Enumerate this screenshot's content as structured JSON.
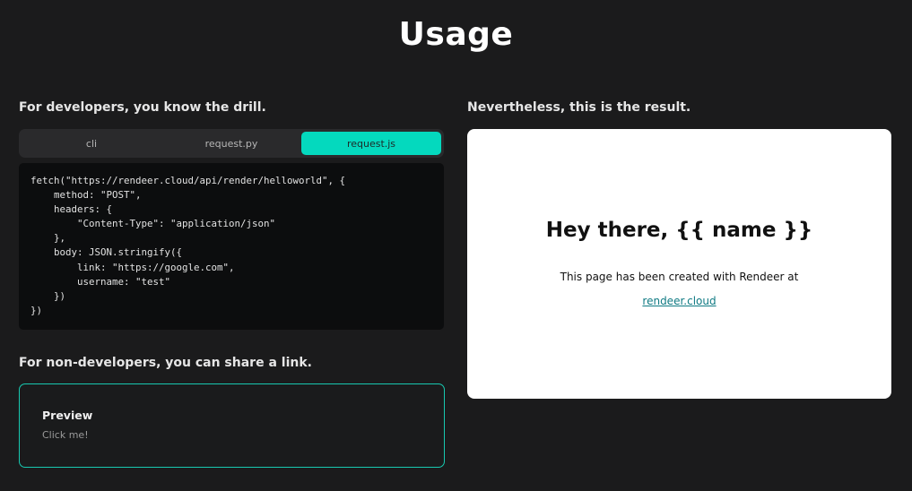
{
  "page": {
    "title": "Usage"
  },
  "developers": {
    "heading": "For developers, you know the drill.",
    "tabs": [
      {
        "label": "cli",
        "active": false
      },
      {
        "label": "request.py",
        "active": false
      },
      {
        "label": "request.js",
        "active": true
      }
    ],
    "code": "fetch(\"https://rendeer.cloud/api/render/helloworld\", {\n    method: \"POST\",\n    headers: {\n        \"Content-Type\": \"application/json\"\n    },\n    body: JSON.stringify({\n        link: \"https://google.com\",\n        username: \"test\"\n    })\n})"
  },
  "non_developers": {
    "heading": "For non-developers, you can share a link.",
    "preview_title": "Preview",
    "preview_subtitle": "Click me!"
  },
  "result": {
    "heading": "Nevertheless, this is the result.",
    "render_heading": "Hey there, {{ name }}",
    "render_text": "This page has been created with Rendeer at",
    "render_link": "rendeer.cloud"
  },
  "colors": {
    "background": "#1b1b1c",
    "accent": "#04d9be",
    "code_background": "#0c0d0e",
    "link": "#0f7a83"
  }
}
